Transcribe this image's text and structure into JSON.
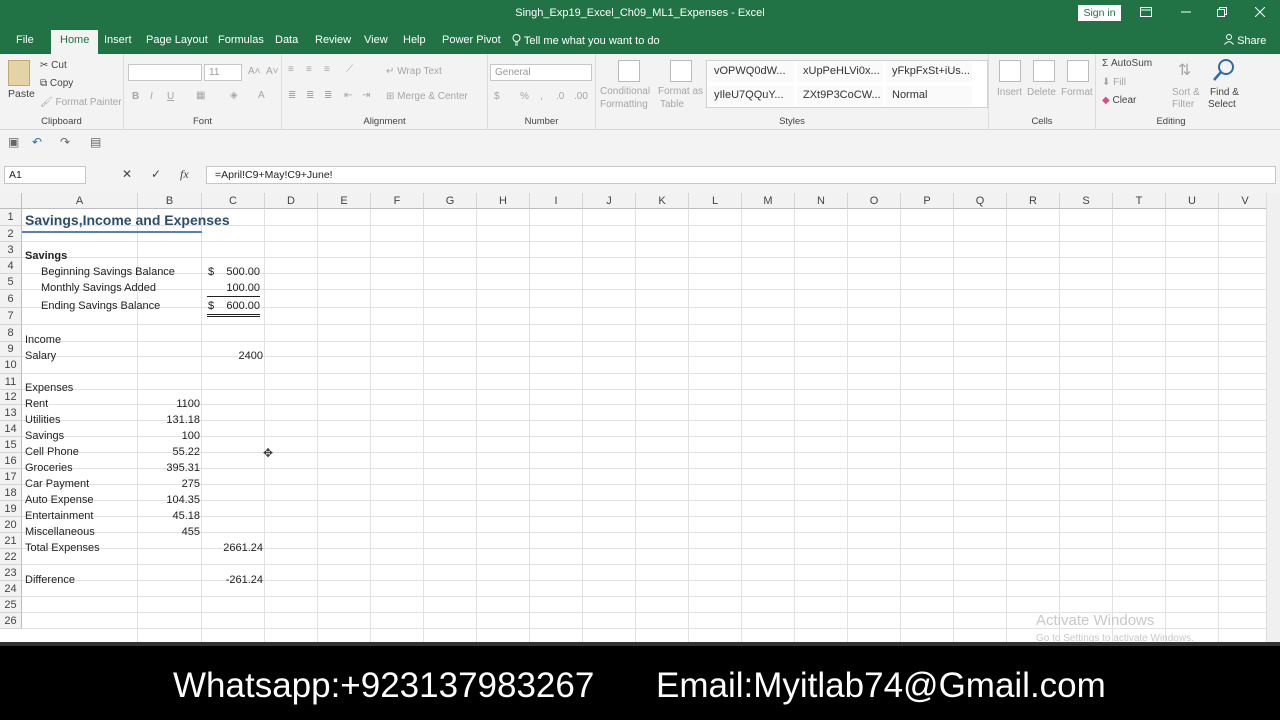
{
  "window": {
    "title": "Singh_Exp19_Excel_Ch09_ML1_Expenses - Excel",
    "sign_in": "Sign in",
    "ribbon_display_icon": "ribbon-display-icon",
    "minimize_icon": "minimize-icon",
    "restore_icon": "restore-icon",
    "close_icon": "close-icon"
  },
  "menu": {
    "file": "File",
    "home": "Home",
    "insert": "Insert",
    "page_layout": "Page Layout",
    "formulas": "Formulas",
    "data": "Data",
    "review": "Review",
    "view": "View",
    "help": "Help",
    "power_pivot": "Power Pivot",
    "tell_me": "Tell me what you want to do",
    "share": "Share"
  },
  "ribbon": {
    "clipboard": {
      "label": "Clipboard",
      "paste": "Paste",
      "cut": "Cut",
      "copy": "Copy",
      "format_painter": "Format Painter"
    },
    "font": {
      "label": "Font",
      "size": "11",
      "bold": "B",
      "italic": "I",
      "underline": "U"
    },
    "alignment": {
      "label": "Alignment",
      "wrap_text": "Wrap Text",
      "merge_center": "Merge & Center"
    },
    "number": {
      "label": "Number",
      "format": "General",
      "currency": "$",
      "percent": "%",
      "comma": ","
    },
    "styles": {
      "label": "Styles",
      "conditional_formatting_1": "Conditional",
      "conditional_formatting_2": "Formatting",
      "format_as_table_1": "Format as",
      "format_as_table_2": "Table",
      "cells": [
        "vOPWQ0dW...",
        "xUpPeHLVi0x...",
        "yFkpFxSt+iUs...",
        "yIleU7QQuY...",
        "ZXt9P3CoCW...",
        "Normal"
      ]
    },
    "cells": {
      "label": "Cells",
      "insert": "Insert",
      "delete": "Delete",
      "format": "Format"
    },
    "editing": {
      "label": "Editing",
      "autosum": "AutoSum",
      "fill": "Fill",
      "clear": "Clear",
      "sort_filter_1": "Sort &",
      "sort_filter_2": "Filter",
      "find_select_1": "Find &",
      "find_select_2": "Select"
    }
  },
  "formula_bar": {
    "name_box": "A1",
    "fx": "fx",
    "formula": "=April!C9+May!C9+June!"
  },
  "columns": [
    "A",
    "B",
    "C",
    "D",
    "E",
    "F",
    "G",
    "H",
    "I",
    "J",
    "K",
    "L",
    "M",
    "N",
    "O",
    "P",
    "Q",
    "R",
    "S",
    "T",
    "U",
    "V"
  ],
  "rows": [
    "1",
    "2",
    "3",
    "4",
    "5",
    "6",
    "7",
    "8",
    "9",
    "10",
    "11",
    "12",
    "13",
    "14",
    "15",
    "16",
    "17",
    "18",
    "19",
    "20",
    "21",
    "22",
    "23",
    "24",
    "25",
    "26"
  ],
  "sheet": {
    "title": "Savings,Income and Expenses",
    "savings_header": "Savings",
    "beginning_label": "Beginning Savings Balance",
    "beginning_dollar": "$",
    "beginning_value": "500.00",
    "monthly_label": "Monthly Savings Added",
    "monthly_value": "100.00",
    "ending_label": "Ending Savings Balance",
    "ending_dollar": "$",
    "ending_value": "600.00",
    "income_header": "Income",
    "salary_label": "Salary",
    "salary_value": "2400",
    "expenses_header": "Expenses",
    "expenses": [
      {
        "label": "Rent",
        "value": "1100"
      },
      {
        "label": "Utilities",
        "value": "131.18"
      },
      {
        "label": "Savings",
        "value": "100"
      },
      {
        "label": "Cell Phone",
        "value": "55.22"
      },
      {
        "label": "Groceries",
        "value": "395.31"
      },
      {
        "label": "Car Payment",
        "value": "275"
      },
      {
        "label": "Auto Expense",
        "value": "104.35"
      },
      {
        "label": "Entertainment",
        "value": "45.18"
      },
      {
        "label": "Miscellaneous",
        "value": "455"
      }
    ],
    "total_label": "Total Expenses",
    "total_value": "2661.24",
    "difference_label": "Difference",
    "difference_value": "-261.24"
  },
  "watermark": {
    "line1": "Activate Windows",
    "line2": "Go to Settings to activate Windows."
  },
  "banner": {
    "whatsapp": "Whatsapp:+923137983267",
    "email": "Email:Myitlab74@Gmail.com"
  },
  "colors": {
    "accent": "#217346",
    "banner_bg": "#000000"
  }
}
